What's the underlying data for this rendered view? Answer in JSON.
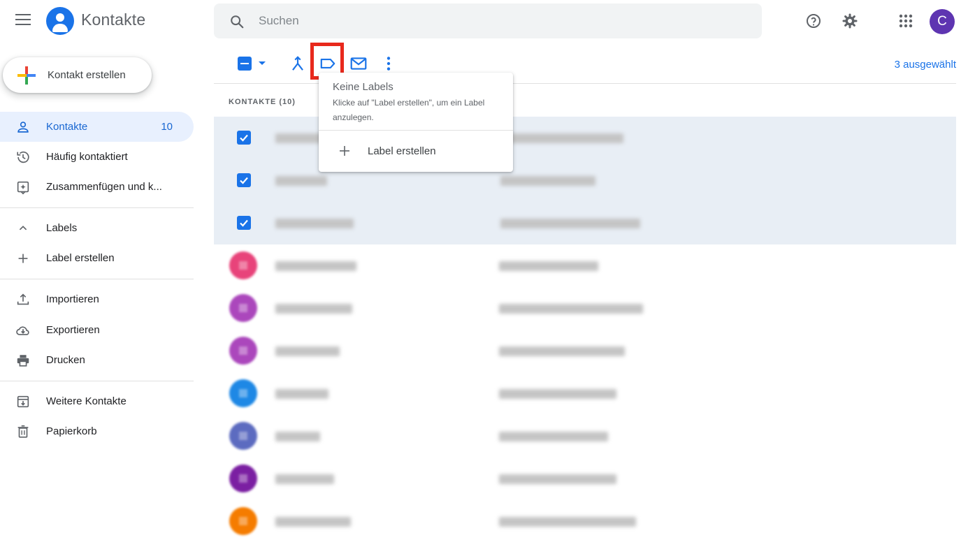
{
  "header": {
    "app_title": "Kontakte",
    "search_placeholder": "Suchen",
    "avatar_letter": "C",
    "avatar_color": "#5e35b1"
  },
  "sidebar": {
    "create_label": "Kontakt erstellen",
    "items": [
      {
        "label": "Kontakte",
        "count": "10",
        "icon": "person-icon",
        "active": true
      },
      {
        "label": "Häufig kontaktiert",
        "icon": "history-icon"
      },
      {
        "label": "Zusammenfügen und k...",
        "icon": "merge-suggest-icon"
      },
      {
        "label": "Labels",
        "icon": "chevron-up-icon"
      },
      {
        "label": "Label erstellen",
        "icon": "plus-icon"
      },
      {
        "label": "Importieren",
        "icon": "upload-icon"
      },
      {
        "label": "Exportieren",
        "icon": "cloud-download-icon"
      },
      {
        "label": "Drucken",
        "icon": "print-icon"
      },
      {
        "label": "Weitere Kontakte",
        "icon": "archive-icon"
      },
      {
        "label": "Papierkorb",
        "icon": "trash-icon"
      }
    ]
  },
  "toolbar": {
    "selected_count": "3 ausgewählt",
    "icons": [
      "select-all-checkbox",
      "merge-icon",
      "label-icon",
      "email-icon",
      "more-vert-icon"
    ]
  },
  "contacts": {
    "section_title": "KONTAKTE (10)",
    "rows": [
      {
        "selected": true
      },
      {
        "selected": true
      },
      {
        "selected": true
      },
      {
        "avatar_color": "#e8437a"
      },
      {
        "avatar_color": "#ab47bc"
      },
      {
        "avatar_color": "#ab47bc"
      },
      {
        "avatar_color": "#1e88e5"
      },
      {
        "avatar_color": "#5c6bc0"
      },
      {
        "avatar_color": "#7b1fa2"
      },
      {
        "avatar_color": "#f57c00"
      }
    ]
  },
  "label_menu": {
    "title": "Keine Labels",
    "description": "Klicke auf \"Label erstellen\", um ein Label anzulegen.",
    "create_label": "Label erstellen"
  },
  "colors": {
    "accent": "#1a73e8",
    "highlight": "#e8291c",
    "selected_row": "#e8eef5"
  }
}
